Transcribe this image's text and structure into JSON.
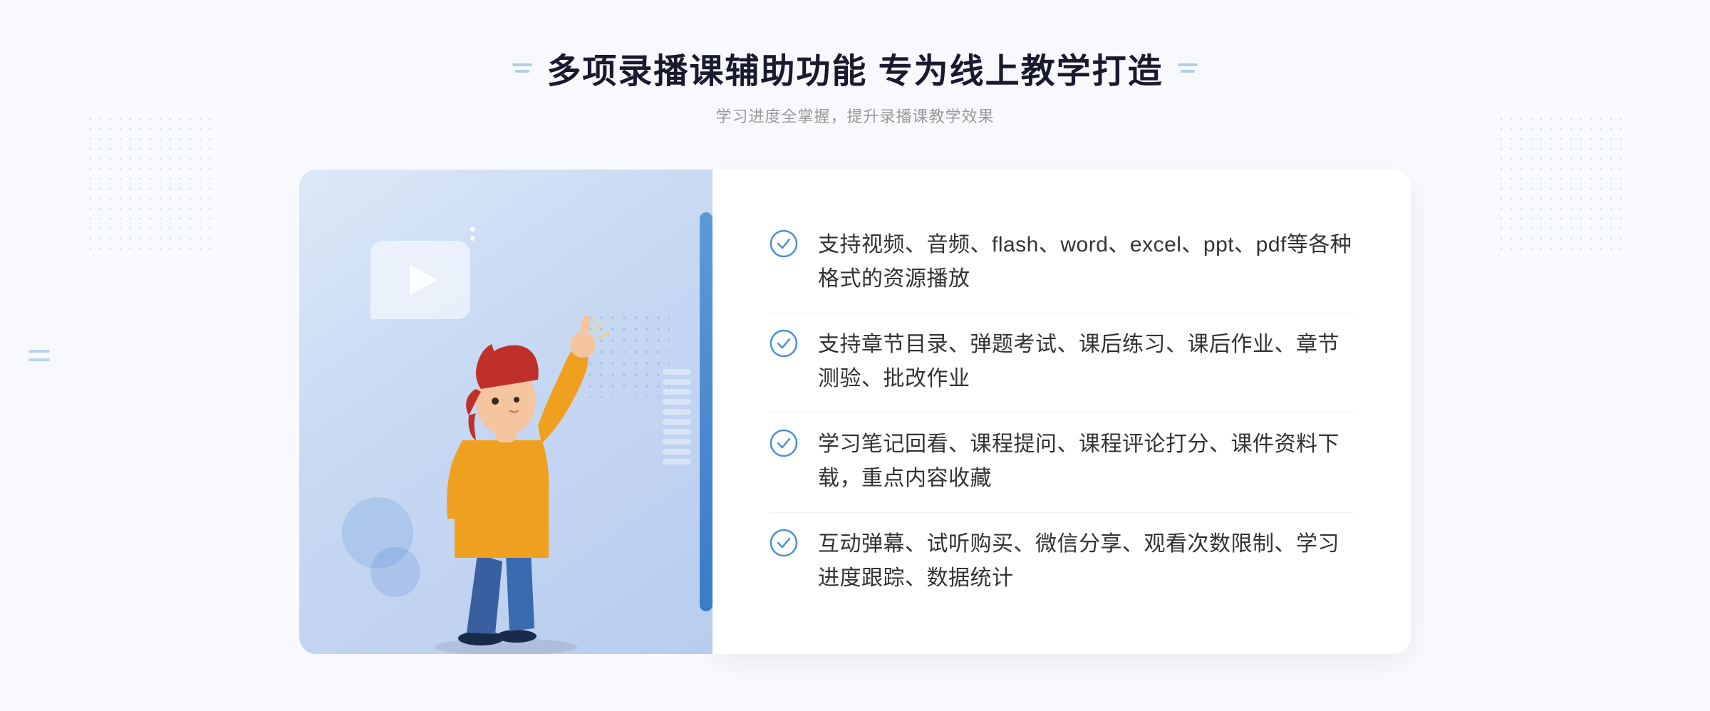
{
  "header": {
    "main_title": "多项录播课辅助功能 专为线上教学打造",
    "subtitle": "学习进度全掌握，提升录播课教学效果"
  },
  "features": [
    {
      "id": 1,
      "text": "支持视频、音频、flash、word、excel、ppt、pdf等各种格式的资源播放"
    },
    {
      "id": 2,
      "text": "支持章节目录、弹题考试、课后练习、课后作业、章节测验、批改作业"
    },
    {
      "id": 3,
      "text": "学习笔记回看、课程提问、课程评论打分、课件资料下载，重点内容收藏"
    },
    {
      "id": 4,
      "text": "互动弹幕、试听购买、微信分享、观看次数限制、学习进度跟踪、数据统计"
    }
  ],
  "colors": {
    "accent_blue": "#3a7bc8",
    "light_blue": "#5b9bd5",
    "text_dark": "#1a1a2e",
    "text_gray": "#999999",
    "text_body": "#333333",
    "check_color": "#4a90d9",
    "bg_light": "#f8f9fc"
  }
}
